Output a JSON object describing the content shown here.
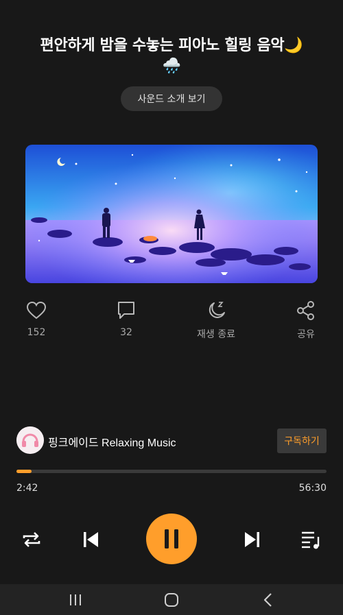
{
  "track": {
    "title_line1": "편안하게 밤을 수놓는 피아노 힐링 음악🌙",
    "title_line2": "🌧️"
  },
  "intro_button": {
    "label": "사운드 소개 보기"
  },
  "cover": {
    "alt": "night sea illustration"
  },
  "actions": {
    "like": {
      "icon": "heart-icon",
      "label": "152"
    },
    "comment": {
      "icon": "comment-icon",
      "label": "32"
    },
    "sleep_timer": {
      "icon": "moon-zz-icon",
      "label": "재생 종료"
    },
    "share": {
      "icon": "share-icon",
      "label": "공유"
    }
  },
  "channel": {
    "name": "핑크에이드 Relaxing Music",
    "subscribe_label": "구독하기"
  },
  "playback": {
    "current_time": "2:42",
    "total_time": "56:30",
    "progress_fraction": 0.048
  },
  "controls": {
    "repeat": "repeat-icon",
    "previous": "skip-previous-icon",
    "play_pause": "pause-icon",
    "next": "skip-next-icon",
    "playlist": "playlist-icon"
  },
  "colors": {
    "accent": "#ff9e2b",
    "background": "#181818"
  }
}
